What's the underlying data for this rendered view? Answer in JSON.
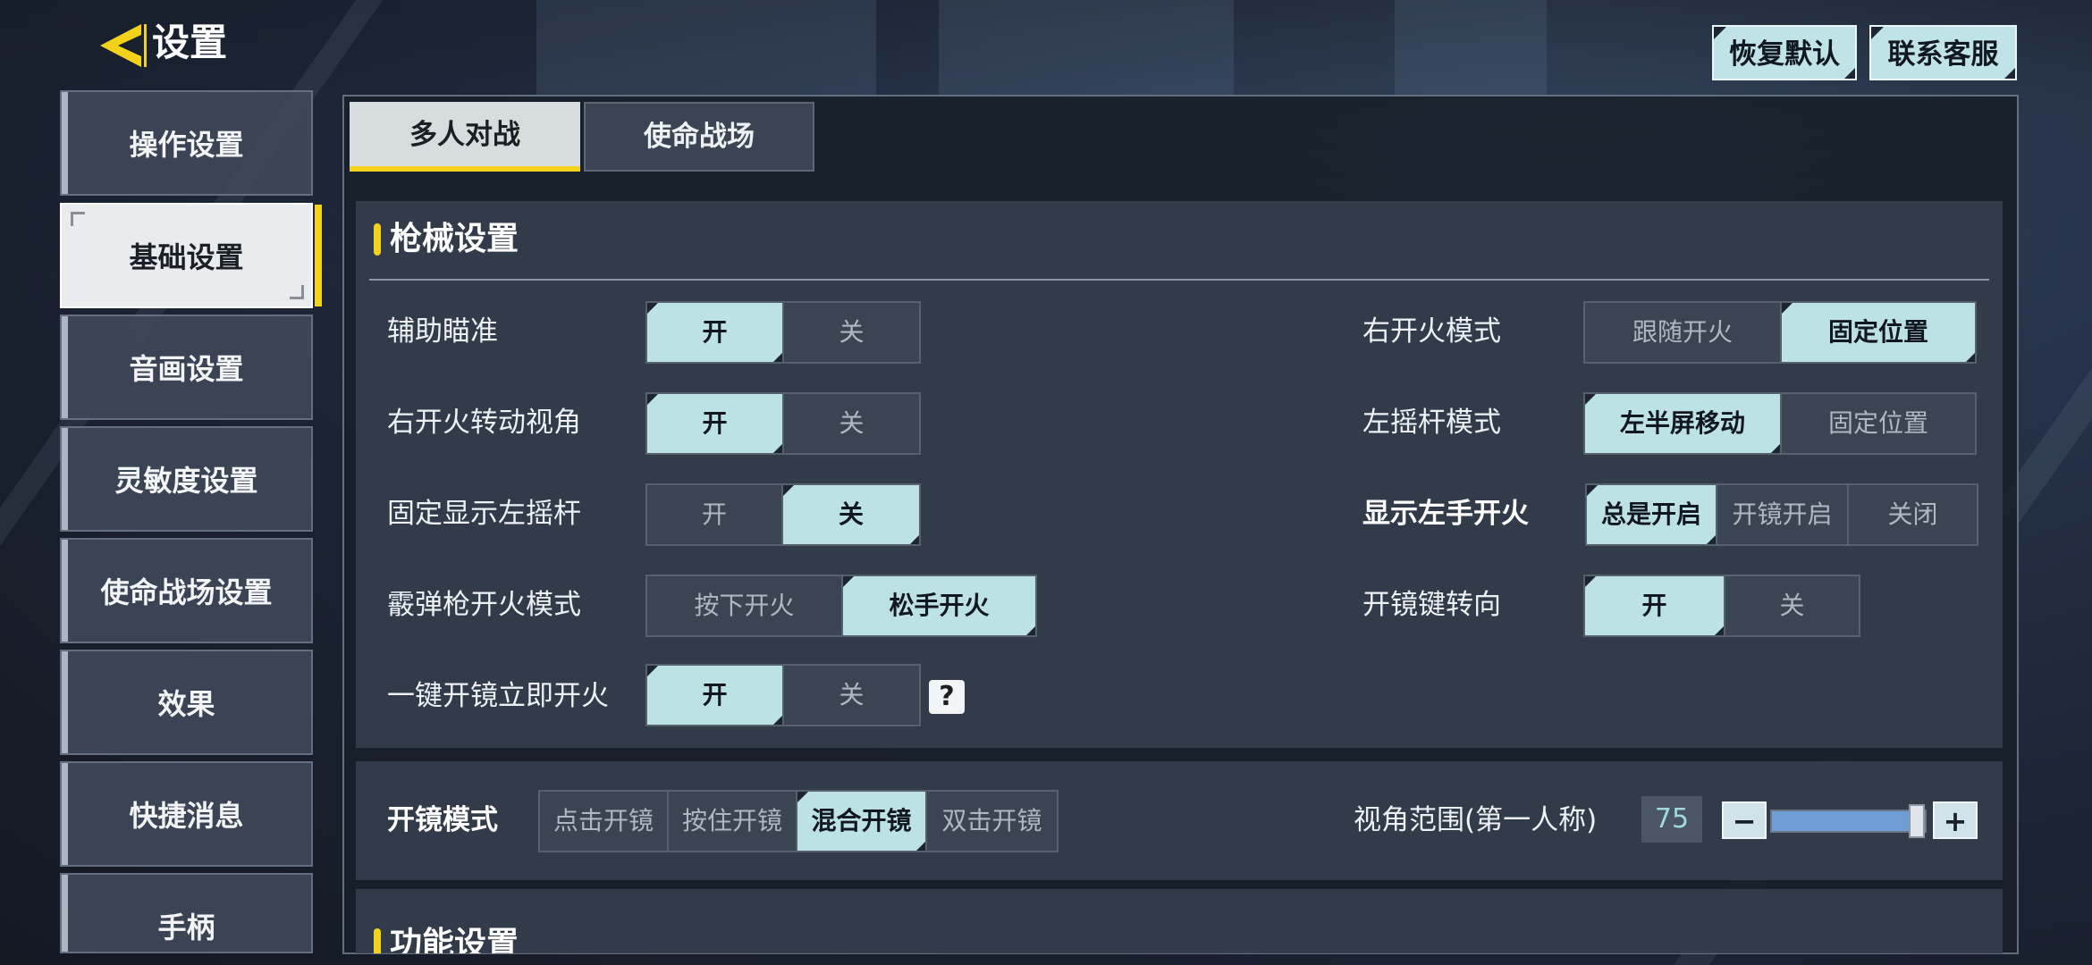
{
  "header": {
    "title": "设置",
    "restore_default": "恢复默认",
    "contact_service": "联系客服"
  },
  "sidebar": {
    "items": [
      {
        "label": "操作设置"
      },
      {
        "label": "基础设置",
        "active": true
      },
      {
        "label": "音画设置"
      },
      {
        "label": "灵敏度设置"
      },
      {
        "label": "使命战场设置"
      },
      {
        "label": "效果"
      },
      {
        "label": "快捷消息"
      },
      {
        "label": "手柄"
      }
    ]
  },
  "tabs": [
    {
      "label": "多人对战",
      "active": true
    },
    {
      "label": "使命战场"
    }
  ],
  "weapon_section": {
    "title": "枪械设置",
    "left": [
      {
        "label": "辅助瞄准",
        "options": [
          "开",
          "关"
        ],
        "selected": "开"
      },
      {
        "label": "右开火转动视角",
        "options": [
          "开",
          "关"
        ],
        "selected": "开"
      },
      {
        "label": "固定显示左摇杆",
        "options": [
          "开",
          "关"
        ],
        "selected": "关"
      },
      {
        "label": "霰弹枪开火模式",
        "options": [
          "按下开火",
          "松手开火"
        ],
        "selected": "松手开火"
      },
      {
        "label": "一键开镜立即开火",
        "options": [
          "开",
          "关"
        ],
        "selected": "开",
        "help": "?"
      }
    ],
    "right": [
      {
        "label": "右开火模式",
        "options": [
          "跟随开火",
          "固定位置"
        ],
        "selected": "固定位置"
      },
      {
        "label": "左摇杆模式",
        "options": [
          "左半屏移动",
          "固定位置"
        ],
        "selected": "左半屏移动"
      },
      {
        "label": "显示左手开火",
        "options": [
          "总是开启",
          "开镜开启",
          "关闭"
        ],
        "selected": "总是开启"
      },
      {
        "label": "开镜键转向",
        "options": [
          "开",
          "关"
        ],
        "selected": "开"
      }
    ]
  },
  "scope_section": {
    "label": "开镜模式",
    "options": [
      "点击开镜",
      "按住开镜",
      "混合开镜",
      "双击开镜"
    ],
    "selected": "混合开镜",
    "fov_label": "视角范围(第一人称)",
    "fov_value": "75",
    "fov_fraction": 0.95,
    "minus": "−",
    "plus": "+"
  },
  "function_section": {
    "title": "功能设置"
  },
  "colors": {
    "accent_yellow": "#f3d21c",
    "selected_option": "#bde2e6"
  }
}
